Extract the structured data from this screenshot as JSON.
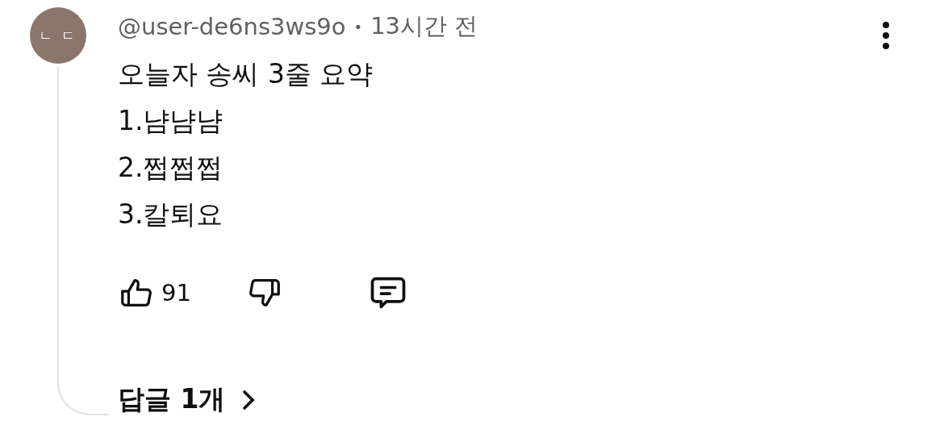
{
  "comment": {
    "avatar": {
      "initials": "ㄴ ㄷ",
      "color": "#8b766c"
    },
    "author": "@user-de6ns3ws9o",
    "separator": "•",
    "time": "13시간 전",
    "lines": [
      "오늘자 송씨 3줄 요약",
      "1.냠냠냠",
      "2.쩝쩝쩝",
      "3.칼퇴요"
    ],
    "likes": "91",
    "replies": "답글 1개"
  }
}
